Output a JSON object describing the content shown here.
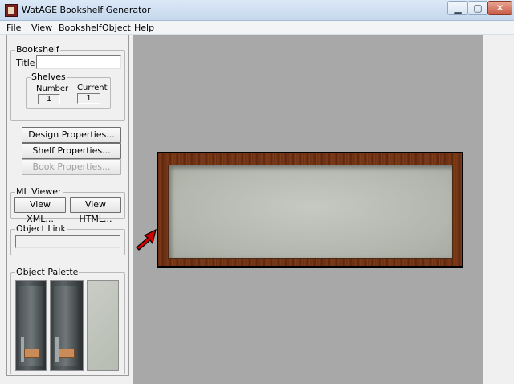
{
  "window": {
    "title": "WatAGE Bookshelf Generator",
    "controls": {
      "minimize": "▁",
      "maximize": "▢",
      "close": "✕"
    }
  },
  "menu": {
    "items": [
      "File",
      "View",
      "Bookshelf",
      "Object",
      "Help"
    ]
  },
  "left_panel": {
    "bookshelf_group": {
      "label": "Bookshelf",
      "title_label": "Title",
      "title_value": "",
      "shelves": {
        "label": "Shelves",
        "number_label": "Number",
        "number_value": "1",
        "current_label": "Current",
        "current_value": "1"
      }
    },
    "buttons": {
      "design": "Design Properties...",
      "shelf": "Shelf Properties...",
      "book": "Book Properties..."
    },
    "ml_viewer": {
      "label": "ML Viewer",
      "view_xml": "View XML...",
      "view_html": "View HTML..."
    },
    "object_link": {
      "label": "Object Link",
      "value": ""
    },
    "object_palette": {
      "label": "Object Palette"
    }
  },
  "colors": {
    "canvas": "#a8a8a8",
    "shelf_wood": "#6a2e12",
    "shelf_back": "#bfc2bb",
    "pointer": "#c00000"
  }
}
